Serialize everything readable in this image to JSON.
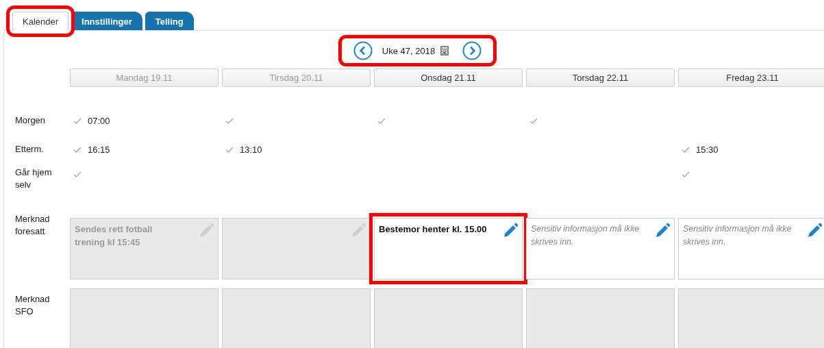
{
  "tabs": [
    {
      "label": "Kalender",
      "selected": true,
      "highlighted": true
    },
    {
      "label": "Innstillinger",
      "selected": false,
      "highlighted": false
    },
    {
      "label": "Telling",
      "selected": false,
      "highlighted": false
    }
  ],
  "week_nav": {
    "label": "Uke 47, 2018",
    "highlighted": true
  },
  "row_labels": {
    "morning": "Morgen",
    "afternoon": "Etterm.",
    "home_alone": "Går hjem selv",
    "parent_note": "Merknad foresatt",
    "sfo_note": "Merknad SFO"
  },
  "days": [
    {
      "header": "Mandag 19.11",
      "disabled": true,
      "morning": {
        "checked": true,
        "time": "07:00"
      },
      "afternoon": {
        "checked": true,
        "time": "16:15"
      },
      "home_alone": {
        "checked": true
      },
      "parent_note": {
        "text": "Sendes rett fotball trening kl 15:45",
        "disabled": true,
        "highlighted": false
      },
      "sfo_note": {
        "disabled": true
      }
    },
    {
      "header": "Tirsdag 20.11",
      "disabled": true,
      "morning": {
        "checked": true
      },
      "afternoon": {
        "checked": true,
        "time": "13:10"
      },
      "home_alone": {
        "checked": false
      },
      "parent_note": {
        "disabled": true,
        "highlighted": false
      },
      "sfo_note": {
        "disabled": true
      }
    },
    {
      "header": "Onsdag 21.11",
      "disabled": false,
      "morning": {
        "checked": true
      },
      "afternoon": {
        "checked": false
      },
      "home_alone": {
        "checked": false
      },
      "parent_note": {
        "text": "Bestemor henter kl. 15.00",
        "disabled": false,
        "highlighted": true
      },
      "sfo_note": {
        "disabled": true
      }
    },
    {
      "header": "Torsdag 22.11",
      "disabled": false,
      "morning": {
        "checked": true
      },
      "afternoon": {
        "checked": false
      },
      "home_alone": {
        "checked": false
      },
      "parent_note": {
        "placeholder": "Sensitiv informasjon må ikke skrives inn.",
        "disabled": false,
        "highlighted": false
      },
      "sfo_note": {
        "disabled": true
      }
    },
    {
      "header": "Fredag 23.11",
      "disabled": false,
      "morning": {
        "checked": false
      },
      "afternoon": {
        "checked": true,
        "time": "15:30"
      },
      "home_alone": {
        "checked": true
      },
      "parent_note": {
        "placeholder": "Sensitiv informasjon må ikke skrives inn.",
        "disabled": false,
        "highlighted": false
      },
      "sfo_note": {
        "disabled": true
      }
    }
  ]
}
